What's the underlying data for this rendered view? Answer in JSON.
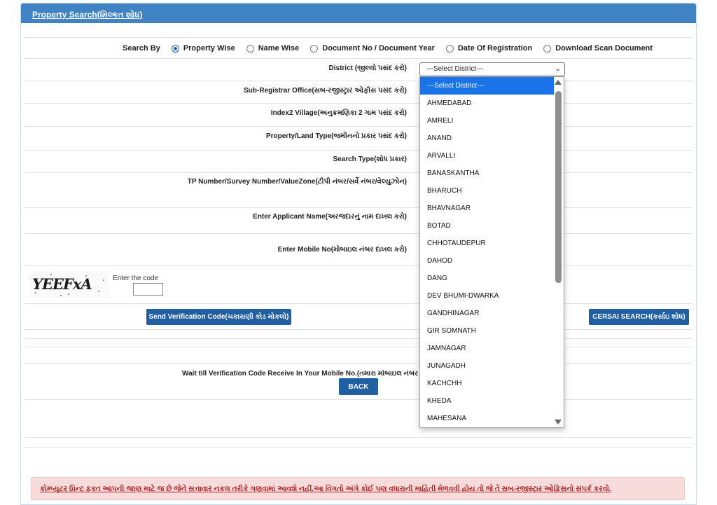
{
  "panel": {
    "title": "Property Search(મિલ્કત શોધ)"
  },
  "search_by": {
    "label": "Search By",
    "options": [
      {
        "label": "Property Wise",
        "checked": true
      },
      {
        "label": "Name Wise",
        "checked": false
      },
      {
        "label": "Document No / Document Year",
        "checked": false
      },
      {
        "label": "Date Of Registration",
        "checked": false
      },
      {
        "label": "Download Scan Document",
        "checked": false
      }
    ]
  },
  "fields": {
    "district": "District (જીલ્લો પસંદ કરો)",
    "sro": "Sub-Registrar Office(સબ-રજીસ્ટ્રાર ઓફીસ પસંદ કરો)",
    "village": "Index2 Village(અનુક્રમણિકા 2 ગામ પસંદ કરો)",
    "property_type": "Property/Land Type(જમીનનો પ્રકાર પસંદ કરો)",
    "search_type": "Search Type(શોધ પ્રકાર)",
    "tp_number": "TP Number/Survey Number/ValueZone(ટીપી નંબર/સર્વે નંબર/વેલ્યુઝોન)",
    "applicant_name": "Enter Applicant Name(અરજદારનું નામ દાખલ કરો)",
    "mobile": "Enter Mobile No(મોબાઇલ નંબર દાખલ કરો)"
  },
  "district_select": {
    "value": "---Select District---",
    "options": [
      "---Select District---",
      "AHMEDABAD",
      "AMRELI",
      "ANAND",
      "ARVALLI",
      "BANASKANTHA",
      "BHARUCH",
      "BHAVNAGAR",
      "BOTAD",
      "CHHOTAUDEPUR",
      "DAHOD",
      "DANG",
      "DEV BHUMI-DWARKA",
      "GANDHINAGAR",
      "GIR SOMNATH",
      "JAMNAGAR",
      "JUNAGADH",
      "KACHCHH",
      "KHEDA",
      "MAHESANA"
    ]
  },
  "captcha": {
    "text": "YEEFxA",
    "label": "Enter the code"
  },
  "buttons": {
    "send_code": "Send Verification Code(ચકાસણી કોડ મોકલો)",
    "cersai": "CERSAI SEARCH(કર્સાઇ શોધ)",
    "back": "BACK"
  },
  "wait_text": "Wait till Verification Code Receive In Your Mobile No.(તમારા મોબાઇલ નંબર પર ચકાસણી કોડ મળે ત્યાં સુધી રાહ જુઓ)",
  "notice": "કોમ્પ્યુટર પ્રિન્ટ ફક્ત આપની જાણ માટે જ છે જેને સત્તાવાર નકલ તરીકે ગણવામાં આવશે નહીં.આ વિગતો અંગે કોઈ પણ વધારાની માહિતી મેળવવી હોય તો જે તે સબ-રજીસ્ટ્રાર ઓફિસનો સંપર્ક કરવો.",
  "colors": {
    "header": "#3f83c4",
    "button": "#1f5fa2",
    "selected": "#1a73e8",
    "notice_bg": "#f8dcdc",
    "notice_text": "#b22222"
  }
}
